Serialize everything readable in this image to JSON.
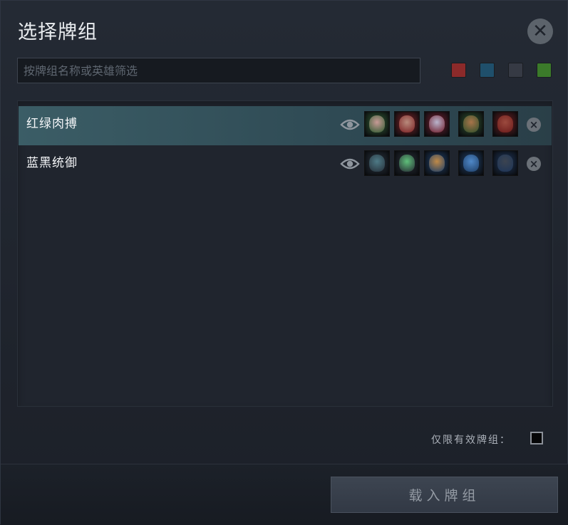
{
  "dialog": {
    "title": "选择牌组",
    "close_icon": "close-icon"
  },
  "search": {
    "placeholder": "按牌组名称或英雄筛选",
    "value": ""
  },
  "color_filters": [
    {
      "name": "red",
      "color": "#8c2a2a"
    },
    {
      "name": "blue",
      "color": "#1f4f6b"
    },
    {
      "name": "black",
      "color": "#363a44"
    },
    {
      "name": "green",
      "color": "#3b7a2a"
    }
  ],
  "decks": [
    {
      "name": "红绿肉搏",
      "selected": true,
      "heroes": [
        {
          "icon": "hero-portrait-icon",
          "frame": "#2f5a30",
          "face": "#c79a96"
        },
        {
          "icon": "hero-portrait-icon",
          "frame": "#7a1f22",
          "face": "#b88a7c"
        },
        {
          "icon": "hero-portrait-icon",
          "frame": "#6e1c2a",
          "face": "#b9b4cc"
        },
        {
          "icon": "hero-portrait-icon",
          "frame": "#2d4f2a",
          "face": "#a8744a"
        },
        {
          "icon": "hero-portrait-icon",
          "frame": "#6a1a1a",
          "face": "#9c4a3e"
        }
      ]
    },
    {
      "name": "蓝黑统御",
      "selected": false,
      "heroes": [
        {
          "icon": "hero-portrait-icon",
          "frame": "#26303a",
          "face": "#4e7a86"
        },
        {
          "icon": "hero-portrait-icon",
          "frame": "#262c34",
          "face": "#5fbf7a"
        },
        {
          "icon": "hero-portrait-icon",
          "frame": "#1e3e66",
          "face": "#c08a48"
        },
        {
          "icon": "hero-portrait-icon",
          "frame": "#1e3e66",
          "face": "#4f88c8"
        },
        {
          "icon": "hero-portrait-icon",
          "frame": "#1c3458",
          "face": "#3c4450"
        }
      ]
    }
  ],
  "valid_only": {
    "label": "仅限有效牌组：",
    "checked": false
  },
  "load_button": {
    "label": "载入牌组"
  }
}
